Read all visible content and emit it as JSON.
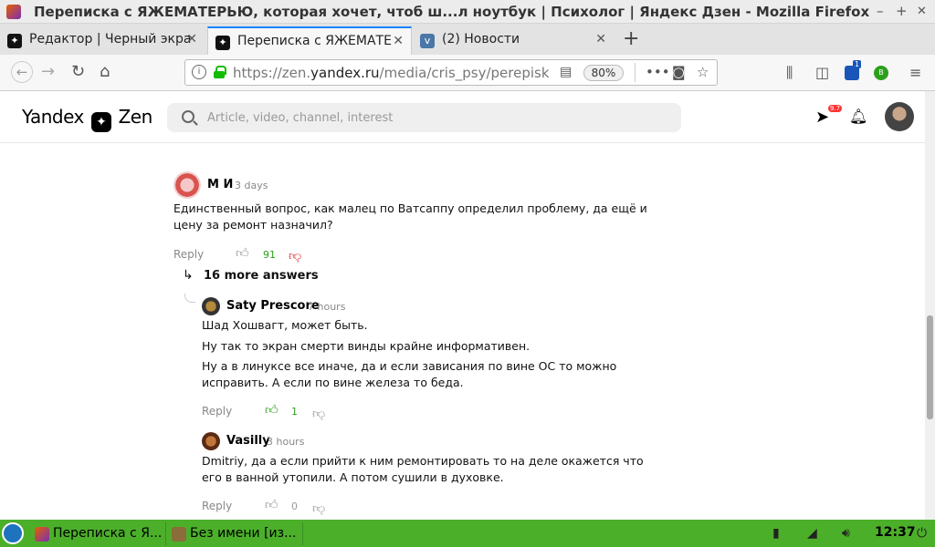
{
  "window": {
    "title": "Переписка с ЯЖЕМАТЕРЬЮ, которая хочет, чтоб ш...л ноутбук | Психолог | Яндекс Дзен - Mozilla Firefox",
    "minimize": "–",
    "maximize": "+",
    "close": "✕"
  },
  "tabs": [
    {
      "label": "Редактор | Черный экра",
      "icon": "zen-icon"
    },
    {
      "label": "Переписка с ЯЖЕМАТЕ",
      "icon": "zen-icon",
      "active": true
    },
    {
      "label": "(2) Новости",
      "icon": "vk-icon"
    }
  ],
  "navbar": {
    "url_prefix": "https://zen.",
    "url_domain": "yandex.ru",
    "url_rest": "/media/cris_psy/perepisk",
    "zoom": "80%"
  },
  "zen": {
    "logo_left": "Yandex",
    "logo_right": "Zen",
    "search_placeholder": "Article, video, channel, interest",
    "notification_badge": "9.7"
  },
  "comments": {
    "main": {
      "author": "М И",
      "time": "3 days",
      "line1": "Единственный вопрос, как малец по Ватсаппу определил проблему, да ещё и",
      "line2": "цену за ремонт назначил?",
      "reply": "Reply",
      "likes": "91"
    },
    "more_answers": "16 more answers",
    "reply1": {
      "author": "Saty Prescore",
      "time": "7 hours",
      "line1": "Шад Хошвагт, может быть.",
      "line2": "Ну так то экран смерти винды крайне информативен.",
      "line3": "Ну а в линуксе все иначе, да и если зависания по вине ОС то можно",
      "line4": "исправить. А если по вине железа то беда.",
      "reply": "Reply",
      "likes": "1"
    },
    "reply2": {
      "author": "Vasilly",
      "time": "3 hours",
      "line1": "Dmitriy, да а если прийти к ним ремонтировать то на деле окажется что",
      "line2": "его в ванной утопили. А потом сушили в духовке.",
      "reply": "Reply",
      "likes": "0"
    }
  },
  "taskbar": {
    "task1": "Переписка с Я...",
    "task2": "Без имени [из...",
    "clock": "12:37"
  },
  "colors": {
    "like_green": "#2ca01c",
    "dislike_red": "#e8272b",
    "taskbar_green": "#4caf2a",
    "firefox_blue": "#0a84ff"
  }
}
